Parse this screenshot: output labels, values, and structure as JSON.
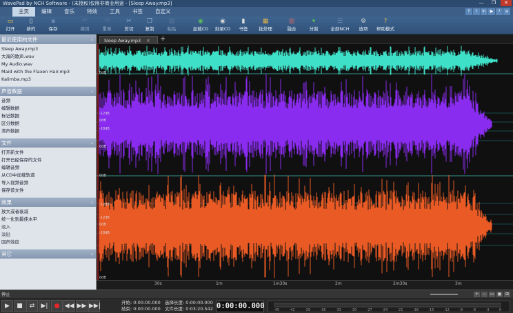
{
  "window": {
    "title": "WavePad by NCH Software - (未授权)仅限非商业用途 - [Sleep Away.mp3]",
    "controls": [
      "—",
      "❐",
      "✕"
    ]
  },
  "menu": {
    "tabs": [
      "主页",
      "编辑",
      "音乐",
      "特效",
      "工具",
      "书签",
      "自定义"
    ],
    "active": "主页",
    "social": [
      "f",
      "t",
      "in",
      "▶",
      "?",
      "≡"
    ]
  },
  "toolbar": {
    "buttons": [
      {
        "id": "open",
        "label": "打开",
        "icon": "folder-icon",
        "glyph": "▭",
        "color": "#f2c043"
      },
      {
        "id": "new",
        "label": "新的",
        "icon": "new-file-icon",
        "glyph": "▯",
        "color": "#eaeaea"
      },
      {
        "id": "save",
        "label": "保存",
        "icon": "save-icon",
        "glyph": "▪",
        "color": "#6d89b3"
      },
      {
        "id": "undo",
        "label": "撤销",
        "icon": "undo-icon",
        "glyph": "↶",
        "color": "#7a8ea8",
        "disabled": true
      },
      {
        "id": "redo",
        "label": "重做",
        "icon": "redo-icon",
        "glyph": "↷",
        "color": "#7a8ea8",
        "disabled": true
      },
      {
        "id": "cut",
        "label": "剪切",
        "icon": "scissors-icon",
        "glyph": "✂",
        "color": "#9ab6d8"
      },
      {
        "id": "copy",
        "label": "复制",
        "icon": "copy-icon",
        "glyph": "❐",
        "color": "#9ab6d8"
      },
      {
        "id": "paste",
        "label": "粘贴",
        "icon": "paste-icon",
        "glyph": "▤",
        "color": "#7a8ea8",
        "disabled": true
      },
      {
        "id": "loadcd",
        "label": "加载CD",
        "icon": "cd-load-icon",
        "glyph": "◉",
        "color": "#5bbd5b"
      },
      {
        "id": "burncd",
        "label": "刻录CD",
        "icon": "cd-burn-icon",
        "glyph": "◉",
        "color": "#d8d8d8"
      },
      {
        "id": "bookmark",
        "label": "书签",
        "icon": "bookmark-icon",
        "glyph": "▮",
        "color": "#e0e0e0"
      },
      {
        "id": "batch",
        "label": "批处理",
        "icon": "batch-icon",
        "glyph": "▦",
        "color": "#e8b64a"
      },
      {
        "id": "join",
        "label": "融合",
        "icon": "join-icon",
        "glyph": "▥",
        "color": "#d06a6a"
      },
      {
        "id": "split",
        "label": "分割",
        "icon": "split-icon",
        "glyph": "▾",
        "color": "#5bbd5b"
      },
      {
        "id": "suite",
        "label": "全部NCH",
        "icon": "nch-suite-icon",
        "glyph": "☰",
        "color": "#6d89b3"
      },
      {
        "id": "tools",
        "label": "选项",
        "icon": "options-icon",
        "glyph": "⚙",
        "color": "#d4d4d4"
      },
      {
        "id": "help",
        "label": "帮助模式",
        "icon": "help-icon",
        "glyph": "?",
        "color": "#e8b64a"
      }
    ]
  },
  "sidebar": {
    "sections": [
      {
        "title": "最近使用的文件",
        "items": [
          "Sleep Away.mp3",
          "大海的歌声.wav",
          "My Audio.wav",
          "Maid with the Flaxen Hair.mp3",
          "Kalimba.mp3"
        ]
      },
      {
        "title": "声音数据",
        "items": [
          "音频",
          "编辑数据",
          "标记数据",
          "区分数据",
          "清声数据"
        ]
      },
      {
        "title": "文件",
        "items": [
          "打开新文件",
          "打开已经保存的文件",
          "编辑音频",
          "从CD中加载轨道",
          "导入视频音频",
          "保存该文件"
        ]
      },
      {
        "title": "效果",
        "items": [
          "放大或者衰减",
          "统一化到最佳水平",
          "淡入",
          "淡出",
          "回声效应"
        ]
      },
      {
        "title": "其它",
        "items": []
      }
    ]
  },
  "editor": {
    "tab_label": "Sleep Away.mp3",
    "tab_close": "✕",
    "add_tab": "+",
    "db_labels": {
      "top": "0dB",
      "upper_mid": "0dB",
      "low1": "-12dB",
      "low2": "-18dB",
      "low3": "-18dB",
      "low4": "-12dB",
      "bottom": "0dB"
    },
    "ruler_ticks": [
      "30s",
      "1m",
      "1m30s",
      "2m",
      "2m30s",
      "3m"
    ]
  },
  "transport": {
    "label": "停止",
    "buttons": [
      {
        "id": "play",
        "glyph": "▶",
        "icon": "play-icon"
      },
      {
        "id": "stop",
        "glyph": "■",
        "icon": "stop-icon"
      },
      {
        "id": "loop",
        "glyph": "⇄",
        "icon": "loop-icon"
      },
      {
        "id": "play-to-end",
        "glyph": "▶|",
        "icon": "play-to-end-icon"
      },
      {
        "id": "record",
        "glyph": "●",
        "icon": "record-icon"
      },
      {
        "id": "rewind",
        "glyph": "◀◀",
        "icon": "rewind-icon"
      },
      {
        "id": "fast-forward",
        "glyph": "▶▶",
        "icon": "fast-forward-icon"
      },
      {
        "id": "skip-end",
        "glyph": "▶▶|",
        "icon": "skip-end-icon"
      }
    ],
    "start_label": "开始:",
    "start_value": "0:00:00.000",
    "end_label": "结束:",
    "end_value": "0:00:00.000",
    "sel_label": "选择长度:",
    "sel_value": "0:00:00.000",
    "file_label": "文件长度:",
    "file_value": "0:03:20.542",
    "time": "0:00:00.000",
    "meter_scale": [
      "-45",
      "-42",
      "-39",
      "-36",
      "-33",
      "-30",
      "-27",
      "-24",
      "-21",
      "-18",
      "-15",
      "-12",
      "-9",
      "-6",
      "-3",
      "0"
    ]
  },
  "colors": {
    "cyan_wave": "#3fe0c8",
    "purple_wave": "#8a2bf0",
    "orange_wave": "#ea5a24",
    "background": "#101010"
  }
}
